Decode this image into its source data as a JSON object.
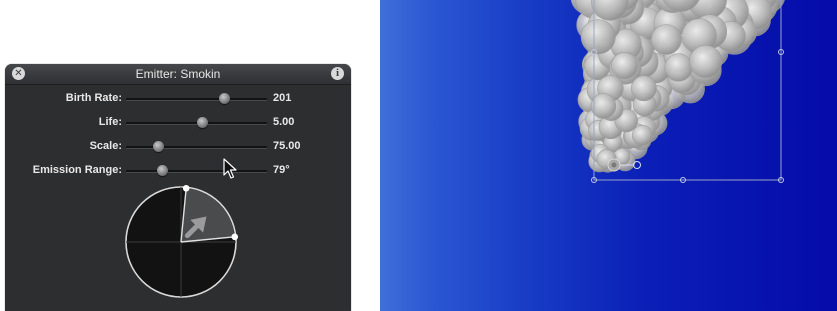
{
  "hud": {
    "title": "Emitter: Smokin",
    "close_icon": "close-x-icon",
    "info_icon": "info-i-icon",
    "info_glyph": "i",
    "close_glyph": "✕"
  },
  "parameters": [
    {
      "label": "Birth Rate:",
      "value": "201",
      "slider_fraction": 0.7
    },
    {
      "label": "Life:",
      "value": "5.00",
      "slider_fraction": 0.54
    },
    {
      "label": "Scale:",
      "value": "75.00",
      "slider_fraction": 0.23
    },
    {
      "label": "Emission Range:",
      "value": "79°",
      "slider_fraction": 0.26
    }
  ],
  "emission_dial": {
    "emission_angle_deg": 45,
    "range_deg": 79,
    "accent_color": "#ffffff",
    "wedge_color": "#4a4b4d"
  },
  "canvas": {
    "background_left": "#3f6fd9",
    "background_right": "#050ba8",
    "particle_color": "#c8c8c8"
  }
}
